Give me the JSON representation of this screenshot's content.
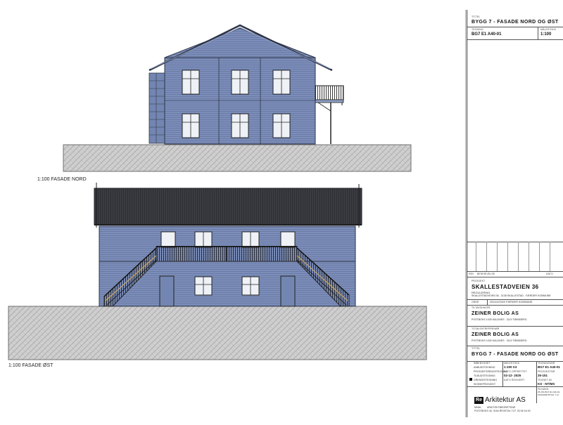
{
  "north": {
    "caption": "1:100   FASADE NORD"
  },
  "east": {
    "caption": "1:100   FASADE ØST"
  },
  "titleblock": {
    "top_tittel_label": "TITTEL",
    "top_title": "BYGG 7 - FASADE NORD OG ØST",
    "tegning_label": "TEGNING",
    "drawing_no": "BG7 E1 A40-01",
    "malestokk_label": "MÅLESTOKK",
    "scale": "1:100",
    "rev_label": "REV",
    "beskrivelse_label": "BESKRIVELSE",
    "dato_label": "DATO",
    "prosjekt_label": "PROSJEKT",
    "project_name": "SKALLESTADVEIEN 36",
    "regulering": "REGULERING",
    "address_line": "SKALLESTADVEIEN 36 - 3138 SKALLESTAD - FÆRDER KOMMUNE",
    "gbnr_label": "GBNR",
    "gbnr": "2511/4/234/0 FÆRDER KOMMUNE",
    "tiltakshaver_label": "TILTAKSHAVER",
    "owner_name": "ZEINER BOLIG AS",
    "owner_address": "POSTBOKS 1030 KALDNES · 3119 TØNSBERG",
    "totalentreprenor_label": "TOTALENTREPRENØR",
    "contractor_name": "ZEINER BOLIG AS",
    "contractor_address": "POSTBOKS 1030 KALDNES · 3119 TØNSBERG",
    "bottom_tittel_label": "TITTEL",
    "bottom_title": "BYGG 7 - FASADE NORD OG ØST",
    "bottom_rows": [
      {
        "label": "SØM BYGGET",
        "col2_label": "MÅLESTOKK",
        "col2_value": "",
        "col3_label": "TEGNINGSNR",
        "col3_value": ""
      },
      {
        "label": "ANBUDSTEGNING",
        "col2_label": "",
        "col2_value": "1:100 A3",
        "col3_label": "",
        "col3_value": "BG7 E1 A40-01"
      },
      {
        "label": "PROSJEKTERINGSTEGNING",
        "col2_label": "DATO OPPRETTET",
        "col2_value": "",
        "col3_label": "PROSJEKTNR",
        "col3_value": ""
      },
      {
        "label": "TILBUDSTEGNING",
        "col2_label": "",
        "col2_value": "02-12- 2025",
        "col3_label": "",
        "col3_value": "25-151"
      },
      {
        "label": "GRENSESTEGNING",
        "col2_label": "DATO REVIDERT",
        "col2_value": "",
        "col3_label": "TEGNET AV",
        "col3_value": ""
      },
      {
        "label": "SKISSEPROSJEKT",
        "col2_label": "",
        "col2_value": "",
        "col3_label": "",
        "col3_value": "KS · NT/MS"
      }
    ],
    "filnavn_label": "FILNAVN",
    "filnavn": "25-151-BG7 E1 A40-01-FASADER BYGG 7.rvt",
    "logo_mark": "Re",
    "firm_name": "Arkitektur AS",
    "firm_sub_left": "MNAL",
    "firm_sub_right": "ARKITEKTBEDRIFTENE",
    "firm_address": "POSTBOKS 40, 3164 REVETAL  TLF. 33 06 16 00"
  }
}
